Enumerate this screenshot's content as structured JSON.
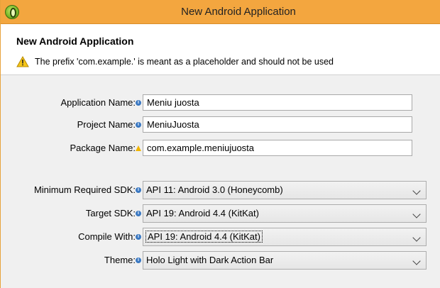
{
  "window": {
    "title": "New Android Application"
  },
  "header": {
    "title": "New Android Application",
    "warning": "The prefix 'com.example.' is meant as a placeholder and should not be used"
  },
  "form": {
    "application_name": {
      "label": "Application Name:",
      "value": "Meniu juosta"
    },
    "project_name": {
      "label": "Project Name:",
      "value": "MeniuJuosta"
    },
    "package_name": {
      "label": "Package Name:",
      "value": "com.example.meniujuosta"
    },
    "min_sdk": {
      "label": "Minimum Required SDK:",
      "value": "API 11: Android 3.0 (Honeycomb)"
    },
    "target_sdk": {
      "label": "Target SDK:",
      "value": "API 19: Android 4.4 (KitKat)"
    },
    "compile_with": {
      "label": "Compile With:",
      "value": "API 19: Android 4.4 (KitKat)"
    },
    "theme": {
      "label": "Theme:",
      "value": "Holo Light with Dark Action Bar"
    }
  },
  "colors": {
    "titlebar": "#f3a63f",
    "info_decor": "#3a78c2",
    "warn_decor": "#f0b400"
  },
  "icons": {
    "app": "android-adt-icon",
    "warning": "warning-icon",
    "info": "info-icon"
  }
}
